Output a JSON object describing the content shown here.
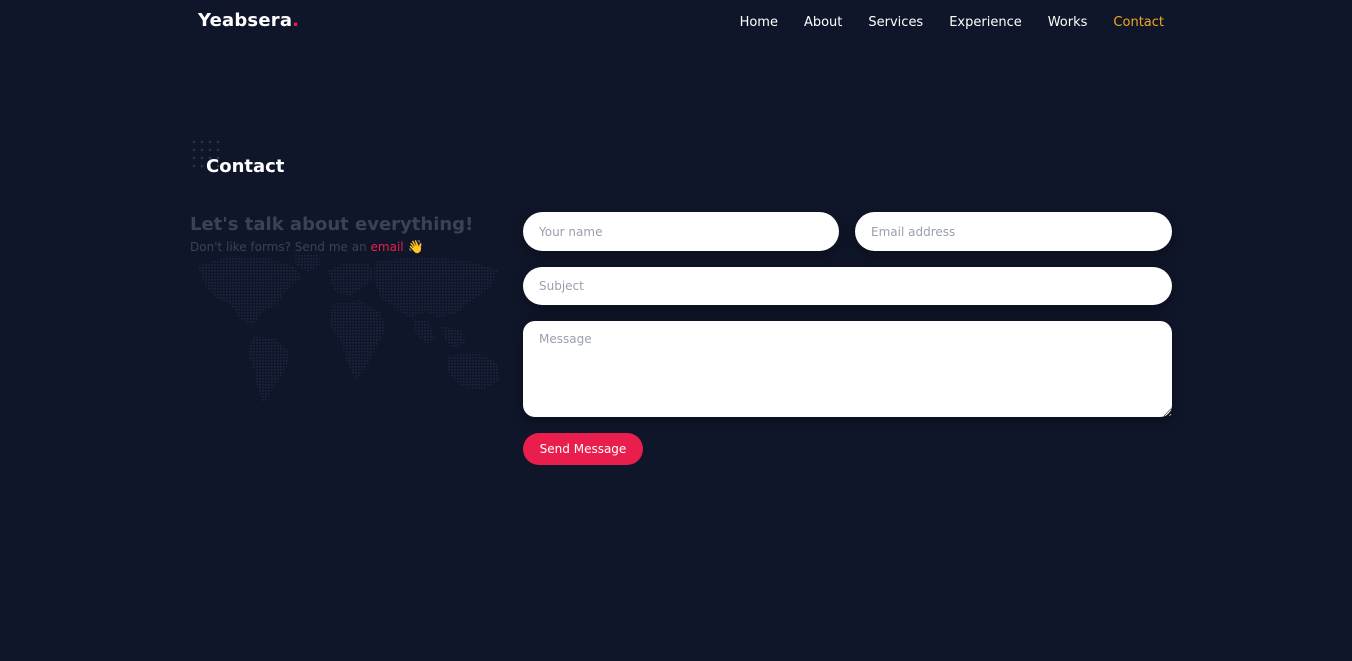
{
  "brand": {
    "name": "Yeabsera",
    "dot": "."
  },
  "nav": {
    "items": [
      {
        "label": "Home"
      },
      {
        "label": "About"
      },
      {
        "label": "Services"
      },
      {
        "label": "Experience"
      },
      {
        "label": "Works"
      },
      {
        "label": "Contact"
      }
    ],
    "active_color": "#f5a623"
  },
  "section": {
    "title": "Contact"
  },
  "intro": {
    "heading": "Let's talk about everything!",
    "text_prefix": "Don't like forms? Send me an ",
    "email_label": "email",
    "wave_icon": "👋"
  },
  "form": {
    "name_placeholder": "Your name",
    "email_placeholder": "Email address",
    "subject_placeholder": "Subject",
    "message_placeholder": "Message",
    "submit_label": "Send Message"
  },
  "colors": {
    "background": "#0f1629",
    "accent": "#e91e4d",
    "muted_text": "#3a4258"
  }
}
